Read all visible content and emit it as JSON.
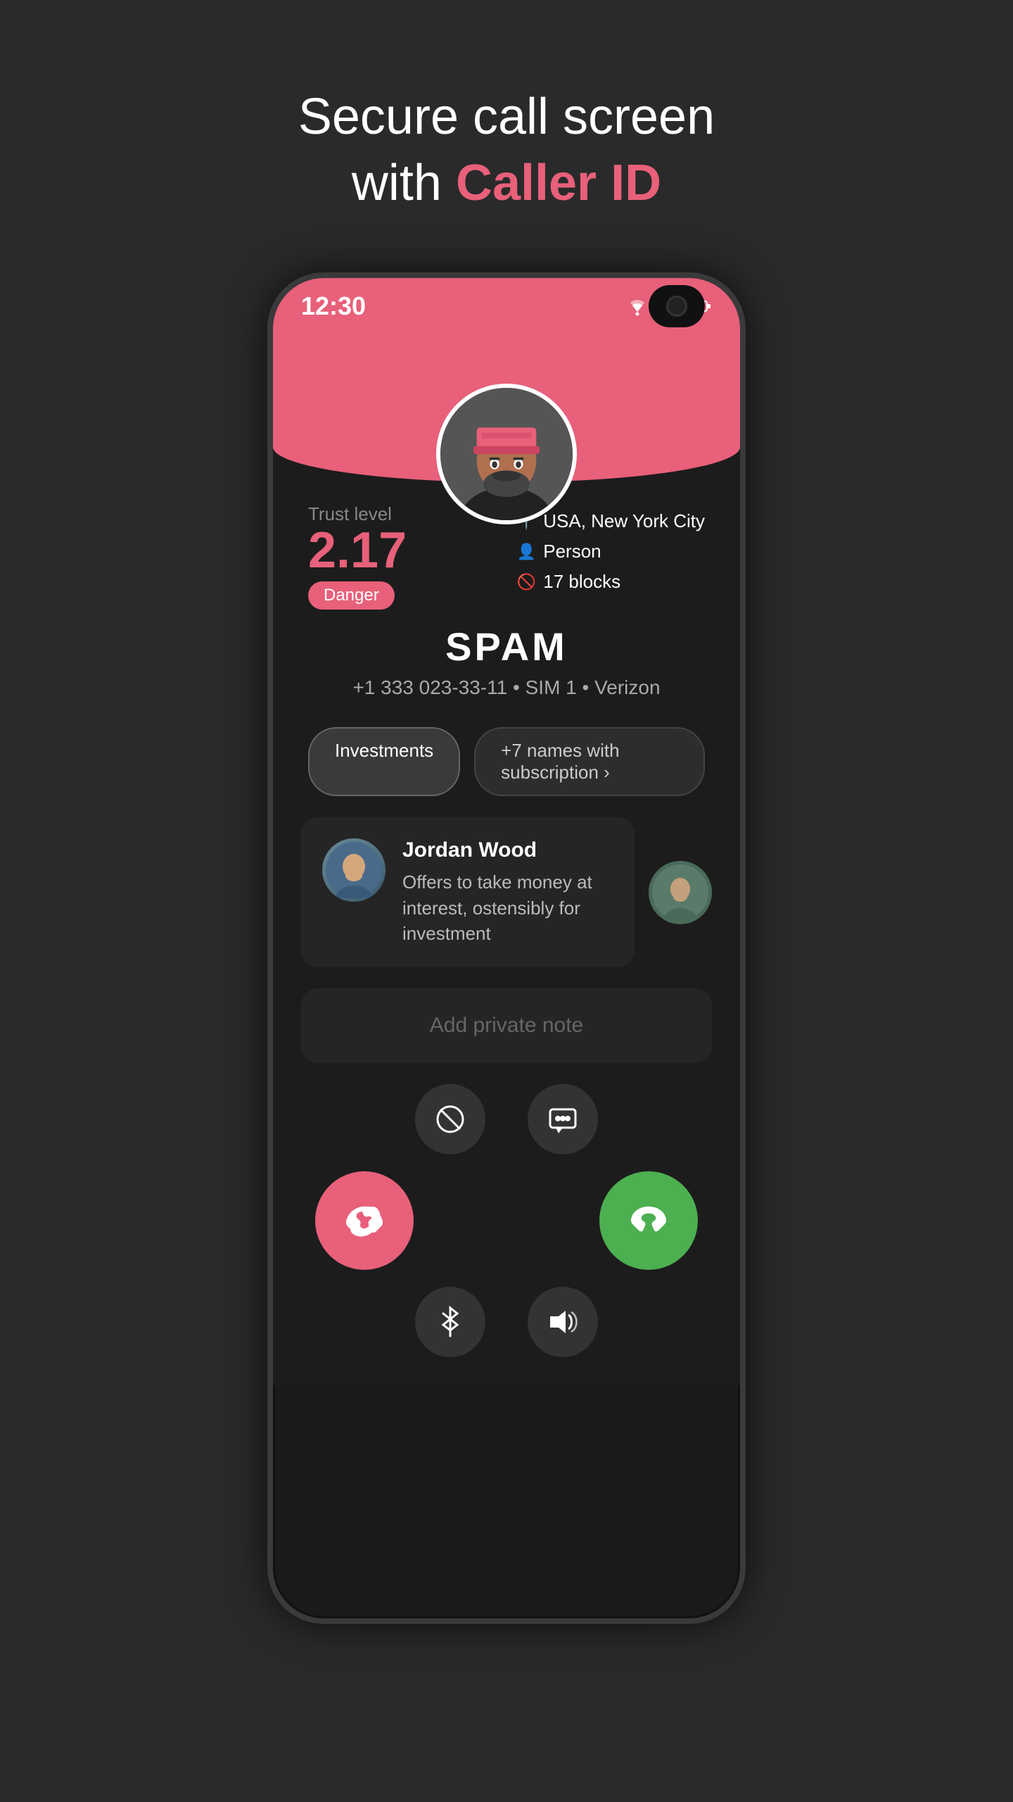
{
  "page": {
    "title_line1": "Secure call screen",
    "title_line2_plain": "with ",
    "title_line2_highlight": "Caller ID"
  },
  "status_bar": {
    "time": "12:30",
    "wifi": "▼",
    "signal": "◀",
    "battery": "🔋"
  },
  "caller": {
    "trust_label": "Trust level",
    "trust_value": "2.17",
    "danger_label": "Danger",
    "location_icon": "📍",
    "location": "USA, New York City",
    "person_icon": "👤",
    "person": "Person",
    "block_icon": "🚫",
    "blocks": "17 blocks",
    "name": "SPAM",
    "number": "+1 333 023-33-11",
    "sim": "SIM 1",
    "carrier": "Verizon",
    "avatar_face": "🧔"
  },
  "tags": {
    "tag1": "Investments",
    "tag2": "+7 names with subscription ›"
  },
  "comment": {
    "reviewer_name": "Jordan Wood",
    "reviewer_avatar": "👴",
    "text": "Offers to take money at interest, ostensibly for investment",
    "side_avatar": "🧔"
  },
  "add_note": {
    "placeholder": "Add private note"
  },
  "actions": {
    "block_label": "⊘",
    "message_label": "💬",
    "bluetooth_label": "✦",
    "volume_label": "🔊",
    "decline_icon": "📞",
    "accept_icon": "📞"
  }
}
